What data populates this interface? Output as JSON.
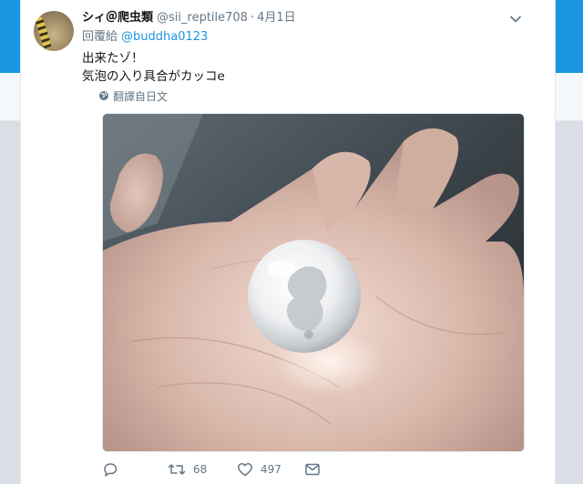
{
  "tweet": {
    "display_name": "シィ＠爬虫類",
    "handle": "@sii_reptile708",
    "separator": "·",
    "date": "4月1日",
    "reply_prefix": "回覆給",
    "reply_to": "@buddha0123",
    "text_lines": [
      "出来たゾ！",
      "気泡の入り具合がカッコe"
    ],
    "translate_label": "翻譯自日文"
  },
  "actions": {
    "retweet_count": "68",
    "like_count": "497"
  },
  "icons": {
    "avatar": "avatar",
    "more": "chevron-down-icon",
    "translate": "globe-icon",
    "reply": "reply-icon",
    "retweet": "retweet-icon",
    "like": "heart-icon",
    "dm": "envelope-icon"
  },
  "colors": {
    "accent": "#1b95e0",
    "text": "#14171a",
    "muted": "#657786",
    "background": "#e6ecf0"
  }
}
